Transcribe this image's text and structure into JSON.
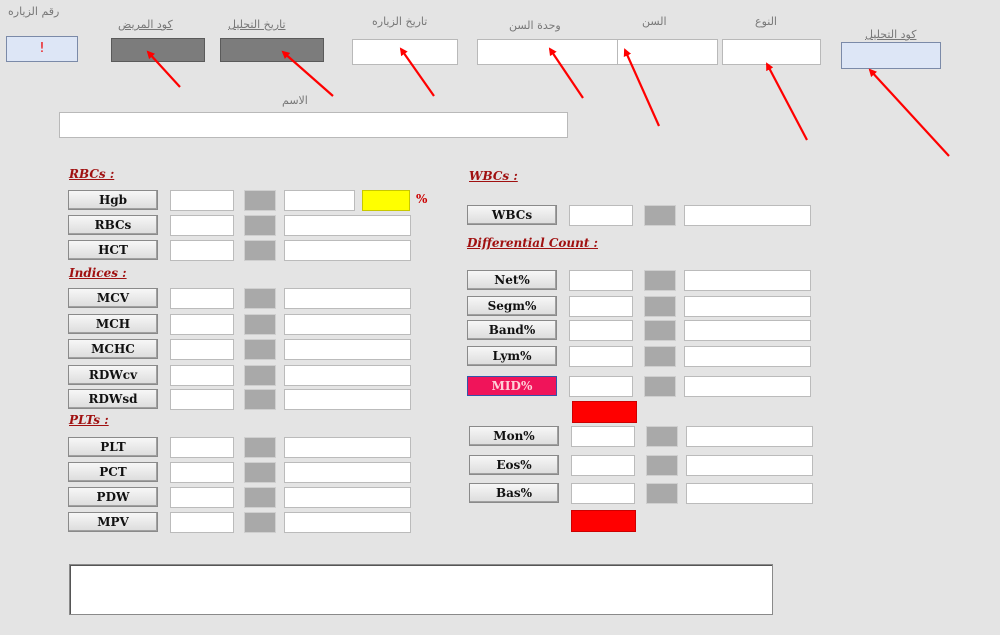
{
  "header": {
    "visit_no_label": "رقم الزياره",
    "visit_no_value": "!",
    "patient_code_label": "كود المريض",
    "analysis_date_label": "تاريخ التحليل",
    "visit_date_label": "تاريخ الزياره",
    "age_unit_label": "وحدة السن",
    "age_label": "السن",
    "gender_label": "النوع",
    "analysis_code_label": "كود التحليل",
    "name_label": "الاسم"
  },
  "sections": {
    "rbcs": "RBCs :",
    "indices": "Indices :",
    "plts": "PLTs :",
    "wbcs": "WBCs :",
    "diff": "Differential Count :"
  },
  "left_buttons": {
    "hgb": "Hgb",
    "rbcs": "RBCs",
    "hct": "HCT",
    "mcv": "MCV",
    "mch": "MCH",
    "mchc": "MCHC",
    "rdwcv": "RDWcv",
    "rdwsd": "RDWsd",
    "plt": "PLT",
    "pct": "PCT",
    "pdw": "PDW",
    "mpv": "MPV"
  },
  "hgb_percent": "%",
  "right_buttons": {
    "wbcs": "WBCs",
    "net": "Net%",
    "segm": "Segm%",
    "band": "Band%",
    "lym": "Lym%",
    "mid": "MID%",
    "mon": "Mon%",
    "eos": "Eos%",
    "bas": "Bas%"
  },
  "colors": {
    "highlight_yellow": "#ffff00",
    "mid_button": "#f0145a",
    "red_box": "#ff0000",
    "section_text": "#a01010",
    "arrow": "#ff0000"
  }
}
